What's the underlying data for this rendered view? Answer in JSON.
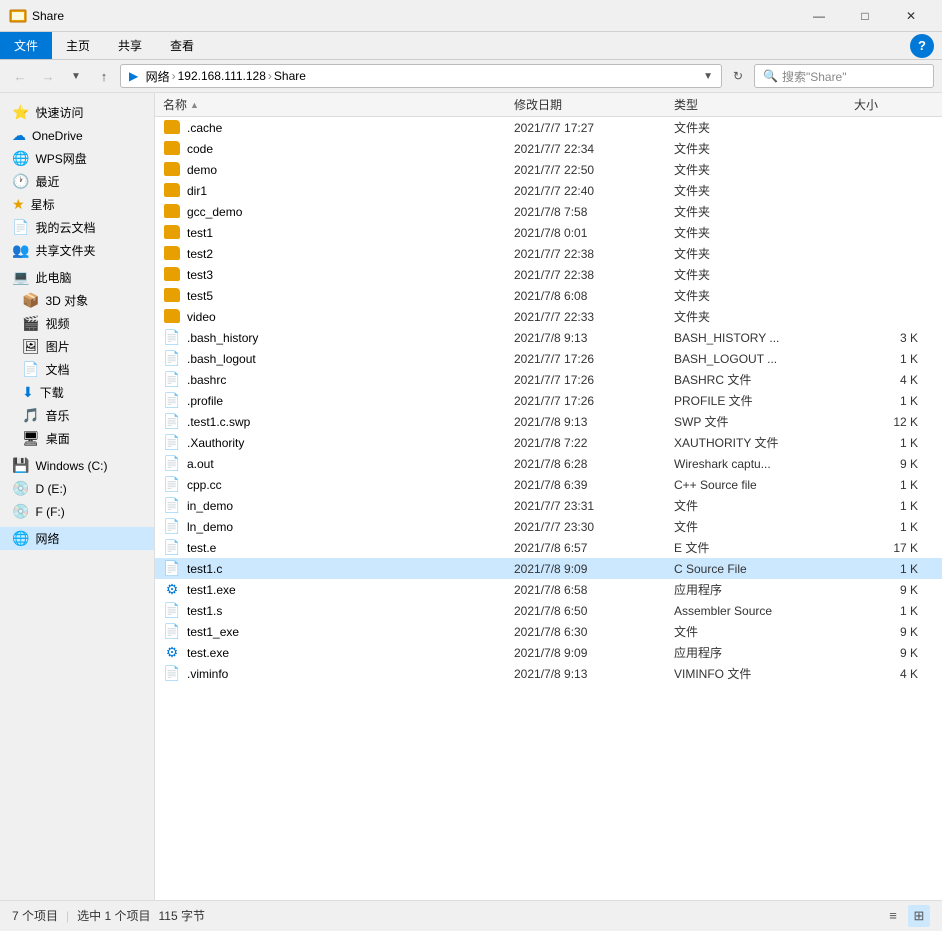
{
  "titleBar": {
    "title": "Share",
    "minimizeLabel": "—",
    "maximizeLabel": "□",
    "closeLabel": "✕"
  },
  "ribbon": {
    "tabs": [
      {
        "id": "file",
        "label": "文件",
        "active": true
      },
      {
        "id": "home",
        "label": "主页",
        "active": false
      },
      {
        "id": "share",
        "label": "共享",
        "active": false
      },
      {
        "id": "view",
        "label": "查看",
        "active": false
      }
    ],
    "helpLabel": "?"
  },
  "addressBar": {
    "pathParts": [
      "网络",
      "192.168.111.128",
      "Share"
    ],
    "searchPlaceholder": "搜索\"Share\"",
    "refreshTitle": "刷新"
  },
  "sidebar": {
    "sections": [
      {
        "items": [
          {
            "id": "quick-access",
            "label": "快速访问",
            "icon": "⭐"
          },
          {
            "id": "onedrive",
            "label": "OneDrive",
            "icon": "☁"
          },
          {
            "id": "wps-cloud",
            "label": "WPS网盘",
            "icon": "🌐"
          },
          {
            "id": "recent",
            "label": "最近",
            "icon": "🕐"
          },
          {
            "id": "starred",
            "label": "星标",
            "icon": "★"
          },
          {
            "id": "my-cloud",
            "label": "我的云文档",
            "icon": "📄"
          },
          {
            "id": "shared-folder",
            "label": "共享文件夹",
            "icon": "👥"
          }
        ]
      },
      {
        "items": [
          {
            "id": "this-pc",
            "label": "此电脑",
            "icon": "💻"
          },
          {
            "id": "3d-objects",
            "label": "3D 对象",
            "icon": "📦"
          },
          {
            "id": "videos",
            "label": "视频",
            "icon": "🎬"
          },
          {
            "id": "pictures",
            "label": "图片",
            "icon": "🖼"
          },
          {
            "id": "documents",
            "label": "文档",
            "icon": "📄"
          },
          {
            "id": "downloads",
            "label": "下载",
            "icon": "⬇"
          },
          {
            "id": "music",
            "label": "音乐",
            "icon": "🎵"
          },
          {
            "id": "desktop",
            "label": "桌面",
            "icon": "🖥"
          }
        ]
      },
      {
        "items": [
          {
            "id": "windows-c",
            "label": "Windows (C:)",
            "icon": "💾"
          },
          {
            "id": "drive-d",
            "label": "D (E:)",
            "icon": "💿"
          },
          {
            "id": "drive-f",
            "label": "F (F:)",
            "icon": "💿"
          }
        ]
      },
      {
        "items": [
          {
            "id": "network",
            "label": "网络",
            "icon": "🌐",
            "selected": true
          }
        ]
      }
    ]
  },
  "fileList": {
    "columns": [
      {
        "id": "name",
        "label": "名称",
        "sortIcon": "▲"
      },
      {
        "id": "modified",
        "label": "修改日期"
      },
      {
        "id": "type",
        "label": "类型"
      },
      {
        "id": "size",
        "label": "大小"
      }
    ],
    "files": [
      {
        "name": ".cache",
        "modified": "2021/7/7 17:27",
        "type": "文件夹",
        "size": "",
        "icon": "📁",
        "isFolder": true
      },
      {
        "name": "code",
        "modified": "2021/7/7 22:34",
        "type": "文件夹",
        "size": "",
        "icon": "📁",
        "isFolder": true
      },
      {
        "name": "demo",
        "modified": "2021/7/7 22:50",
        "type": "文件夹",
        "size": "",
        "icon": "📁",
        "isFolder": true
      },
      {
        "name": "dir1",
        "modified": "2021/7/7 22:40",
        "type": "文件夹",
        "size": "",
        "icon": "📁",
        "isFolder": true
      },
      {
        "name": "gcc_demo",
        "modified": "2021/7/8 7:58",
        "type": "文件夹",
        "size": "",
        "icon": "📁",
        "isFolder": true
      },
      {
        "name": "test1",
        "modified": "2021/7/8 0:01",
        "type": "文件夹",
        "size": "",
        "icon": "📁",
        "isFolder": true
      },
      {
        "name": "test2",
        "modified": "2021/7/7 22:38",
        "type": "文件夹",
        "size": "",
        "icon": "📁",
        "isFolder": true
      },
      {
        "name": "test3",
        "modified": "2021/7/7 22:38",
        "type": "文件夹",
        "size": "",
        "icon": "📁",
        "isFolder": true
      },
      {
        "name": "test5",
        "modified": "2021/7/8 6:08",
        "type": "文件夹",
        "size": "",
        "icon": "📁",
        "isFolder": true
      },
      {
        "name": "video",
        "modified": "2021/7/7 22:33",
        "type": "文件夹",
        "size": "",
        "icon": "📁",
        "isFolder": true
      },
      {
        "name": ".bash_history",
        "modified": "2021/7/8 9:13",
        "type": "BASH_HISTORY ...",
        "size": "3 K",
        "icon": "📄",
        "isFolder": false
      },
      {
        "name": ".bash_logout",
        "modified": "2021/7/7 17:26",
        "type": "BASH_LOGOUT ...",
        "size": "1 K",
        "icon": "📄",
        "isFolder": false
      },
      {
        "name": ".bashrc",
        "modified": "2021/7/7 17:26",
        "type": "BASHRC 文件",
        "size": "4 K",
        "icon": "📄",
        "isFolder": false
      },
      {
        "name": ".profile",
        "modified": "2021/7/7 17:26",
        "type": "PROFILE 文件",
        "size": "1 K",
        "icon": "📄",
        "isFolder": false
      },
      {
        "name": ".test1.c.swp",
        "modified": "2021/7/8 9:13",
        "type": "SWP 文件",
        "size": "12 K",
        "icon": "📄",
        "isFolder": false
      },
      {
        "name": ".Xauthority",
        "modified": "2021/7/8 7:22",
        "type": "XAUTHORITY 文件",
        "size": "1 K",
        "icon": "📄",
        "isFolder": false
      },
      {
        "name": "a.out",
        "modified": "2021/7/8 6:28",
        "type": "Wireshark captu...",
        "size": "9 K",
        "icon": "📄",
        "isFolder": false
      },
      {
        "name": "cpp.cc",
        "modified": "2021/7/8 6:39",
        "type": "C++ Source file",
        "size": "1 K",
        "icon": "📄",
        "isFolder": false
      },
      {
        "name": "in_demo",
        "modified": "2021/7/7 23:31",
        "type": "文件",
        "size": "1 K",
        "icon": "📄",
        "isFolder": false
      },
      {
        "name": "ln_demo",
        "modified": "2021/7/7 23:30",
        "type": "文件",
        "size": "1 K",
        "icon": "📄",
        "isFolder": false
      },
      {
        "name": "test.e",
        "modified": "2021/7/8 6:57",
        "type": "E 文件",
        "size": "17 K",
        "icon": "📄",
        "isFolder": false
      },
      {
        "name": "test1.c",
        "modified": "2021/7/8 9:09",
        "type": "C Source File",
        "size": "1 K",
        "icon": "📄",
        "isFolder": false,
        "selected": true
      },
      {
        "name": "test1.exe",
        "modified": "2021/7/8 6:58",
        "type": "应用程序",
        "size": "9 K",
        "icon": "⚙",
        "isFolder": false
      },
      {
        "name": "test1.s",
        "modified": "2021/7/8 6:50",
        "type": "Assembler Source",
        "size": "1 K",
        "icon": "📄",
        "isFolder": false
      },
      {
        "name": "test1_exe",
        "modified": "2021/7/8 6:30",
        "type": "文件",
        "size": "9 K",
        "icon": "📄",
        "isFolder": false
      },
      {
        "name": "test.exe",
        "modified": "2021/7/8 9:09",
        "type": "应用程序",
        "size": "9 K",
        "icon": "⚙",
        "isFolder": false
      },
      {
        "name": ".viminfo",
        "modified": "2021/7/8 9:13",
        "type": "VIMINFO 文件",
        "size": "4 K",
        "icon": "📄",
        "isFolder": false
      }
    ]
  },
  "statusBar": {
    "totalItems": "7 个项目",
    "selectedInfo": "选中 1 个项目",
    "selectedSize": "115 字节",
    "viewListIcon": "≡",
    "viewGridIcon": "⊞"
  }
}
